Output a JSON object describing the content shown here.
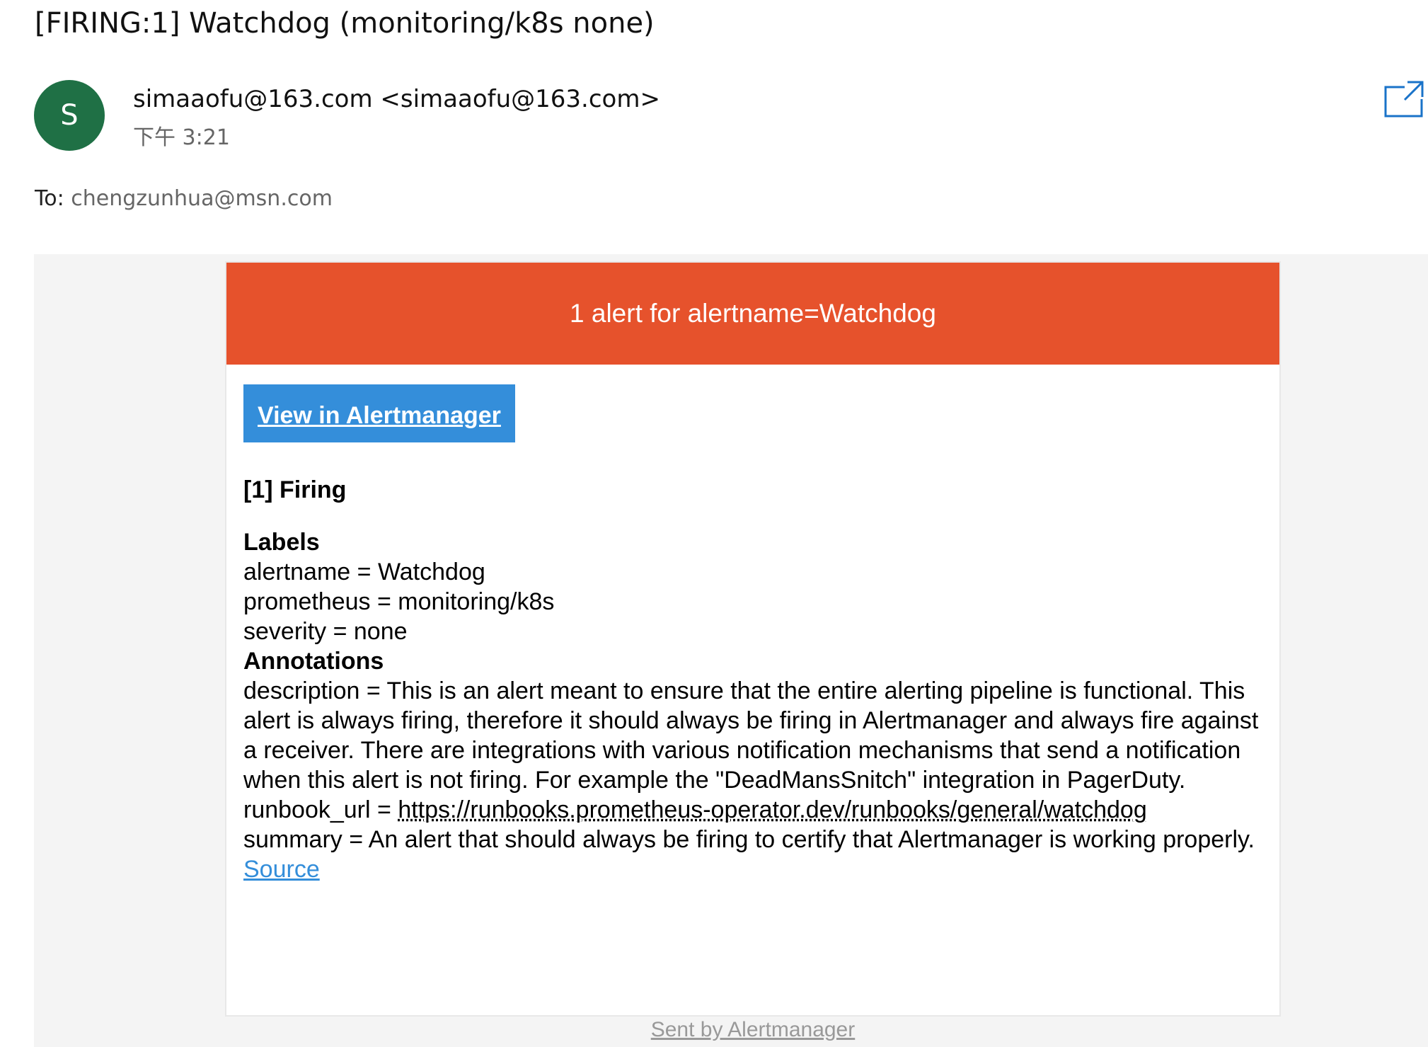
{
  "email": {
    "subject": "[FIRING:1] Watchdog (monitoring/k8s none)",
    "avatar_letter": "S",
    "avatar_color": "#1f7045",
    "sender": "simaaofu@163.com <simaaofu@163.com>",
    "time": "下午 3:21",
    "to_label": "To:",
    "to_address": "chengzunhua@msn.com",
    "popout_icon": "open-in-new-window-icon"
  },
  "alert": {
    "banner_text": "1 alert for alertname=Watchdog",
    "banner_color": "#e6522c",
    "view_button_label": "View in Alertmanager",
    "button_color": "#348eda",
    "firing_heading": "[1] Firing",
    "labels_heading": "Labels",
    "labels": [
      "alertname = Watchdog",
      "prometheus = monitoring/k8s",
      "severity = none"
    ],
    "annotations_heading": "Annotations",
    "description": "description = This is an alert meant to ensure that the entire alerting pipeline is functional. This alert is always firing, therefore it should always be firing in Alertmanager and always fire against a receiver. There are integrations with various notification mechanisms that send a notification when this alert is not firing. For example the \"DeadMansSnitch\" integration in PagerDuty.",
    "runbook_prefix": "runbook_url = ",
    "runbook_url": "https://runbooks.prometheus-operator.dev/runbooks/general/watchdog",
    "summary": "summary = An alert that should always be firing to certify that Alertmanager is working properly.",
    "source_label": "Source"
  },
  "footer": {
    "sent_by": "Sent by Alertmanager"
  }
}
